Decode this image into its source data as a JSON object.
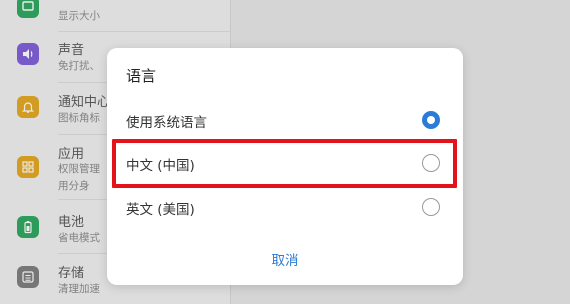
{
  "settings": {
    "items": [
      {
        "title": "",
        "subtitle": "显示大小",
        "icon": "display-icon",
        "color": "#27a65a"
      },
      {
        "title": "声音",
        "subtitle": "免打扰、",
        "icon": "speaker-icon",
        "color": "#7b5bd6"
      },
      {
        "title": "通知中心",
        "subtitle": "图标角标",
        "icon": "bell-icon",
        "color": "#e3a41a"
      },
      {
        "title": "应用",
        "subtitle": "权限管理",
        "subtitle2": "用分身",
        "icon": "apps-icon",
        "color": "#e3a41a"
      },
      {
        "title": "电池",
        "subtitle": "省电模式",
        "icon": "battery-icon",
        "color": "#27a65a"
      },
      {
        "title": "存储",
        "subtitle": "清理加速",
        "icon": "storage-icon",
        "color": "#7a7a7a"
      }
    ]
  },
  "dialog": {
    "title": "语言",
    "options": [
      {
        "label": "使用系统语言",
        "checked": true
      },
      {
        "label": "中文 (中国)",
        "checked": false
      },
      {
        "label": "英文 (美国)",
        "checked": false
      }
    ],
    "cancel_label": "取消"
  },
  "colors": {
    "accent": "#2b7cd6",
    "highlight": "#e3131b"
  }
}
